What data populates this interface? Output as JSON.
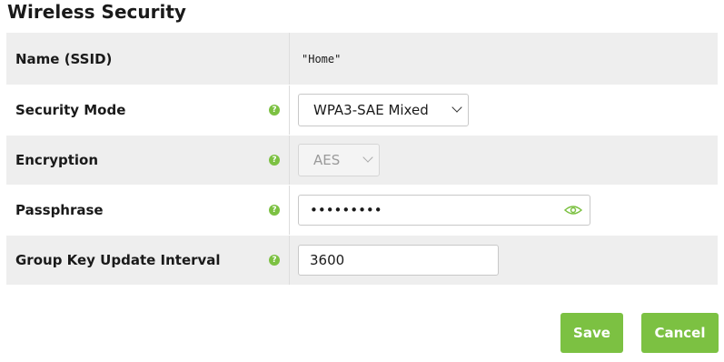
{
  "title": "Wireless Security",
  "fields": {
    "ssid": {
      "label": "Name (SSID)",
      "value": "\"Home\""
    },
    "security_mode": {
      "label": "Security Mode",
      "value": "WPA3-SAE Mixed"
    },
    "encryption": {
      "label": "Encryption",
      "value": "AES"
    },
    "passphrase": {
      "label": "Passphrase",
      "value": "•••••••••"
    },
    "group_key": {
      "label": "Group Key Update Interval",
      "value": "3600"
    }
  },
  "help_glyph": "?",
  "buttons": {
    "save": "Save",
    "cancel": "Cancel"
  },
  "colors": {
    "accent": "#7cc142",
    "row_shade": "#eeeeee"
  },
  "icons": [
    "help-icon",
    "chevron-down-icon",
    "eye-icon"
  ]
}
